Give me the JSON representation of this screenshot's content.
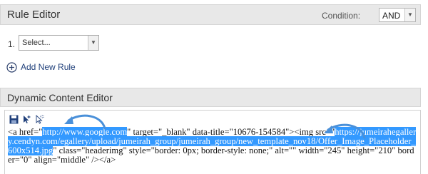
{
  "rule_editor": {
    "title": "Rule Editor",
    "condition_label": "Condition:",
    "condition_value": "AND",
    "rules": [
      {
        "number": "1.",
        "placeholder": "Select..."
      }
    ],
    "add_label": "Add New Rule"
  },
  "content_editor": {
    "title": "Dynamic Content Editor",
    "toolbar_icons": [
      "save-icon",
      "pointer-plus-icon",
      "pointer-select-icon"
    ],
    "code": {
      "seg1": "<a href=\"",
      "href": "http://www.google.com",
      "seg2": "\" target=\"_blank\" data-title=\"10676-154584\"><img src=\"",
      "src": "https://jumeirahegallery.cendyn.com/egallery/upload/jumeirah_group/jumeirah_group/new_template_nov18/Offer_Image_Placeholder_600x514.jpg",
      "seg3": "\" class=\"headerimg\" style=\"border: 0px; border-style: none;\" alt=\"\" width=\"245\" height=\"210\" border=\"0\" align=\"middle\" /></a>"
    }
  },
  "colors": {
    "selection": "#3399ff",
    "annotation_arrow": "#4a90d9",
    "link": "#1f3f7a"
  }
}
